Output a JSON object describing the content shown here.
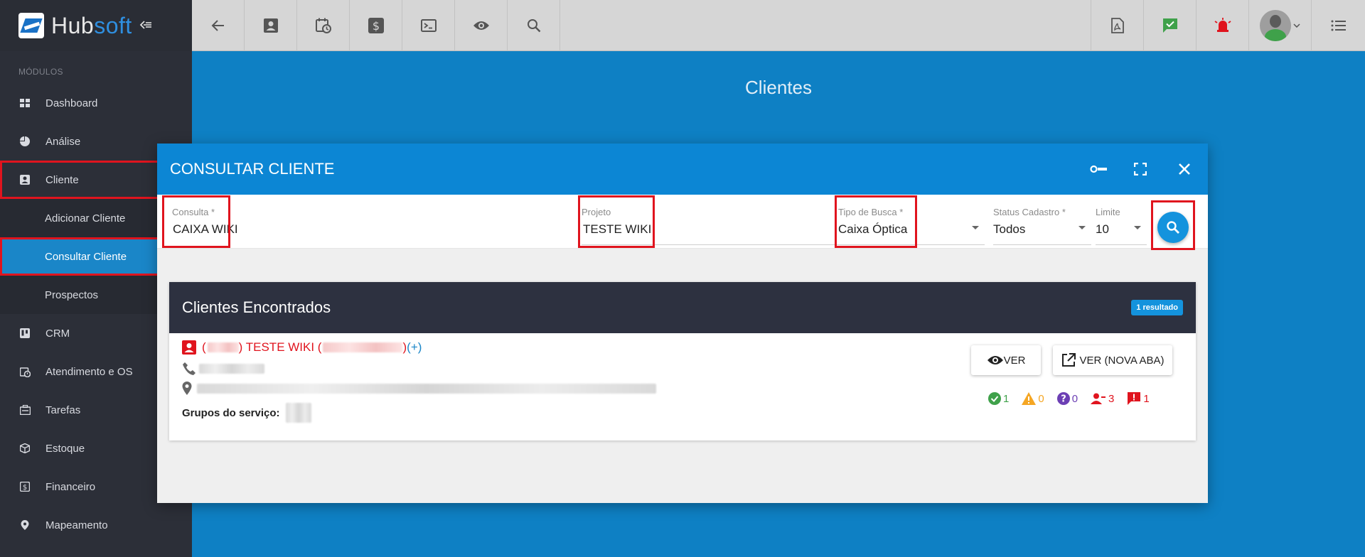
{
  "app": {
    "logo_hub": "Hub",
    "logo_soft": "soft"
  },
  "sidebar": {
    "section_label": "MÓDULOS",
    "items": [
      {
        "label": "Dashboard"
      },
      {
        "label": "Análise"
      },
      {
        "label": "Cliente"
      },
      {
        "label": "CRM"
      },
      {
        "label": "Atendimento e OS"
      },
      {
        "label": "Tarefas"
      },
      {
        "label": "Estoque"
      },
      {
        "label": "Financeiro"
      },
      {
        "label": "Mapeamento"
      }
    ],
    "subitems": [
      {
        "label": "Adicionar Cliente"
      },
      {
        "label": "Consultar Cliente"
      },
      {
        "label": "Prospectos"
      }
    ]
  },
  "page": {
    "title": "Clientes"
  },
  "modal": {
    "title": "CONSULTAR CLIENTE",
    "fields": {
      "consulta": {
        "label": "Consulta",
        "required_mark": "*",
        "value": "CAIXA WIKI"
      },
      "projeto": {
        "label": "Projeto",
        "value": "TESTE WIKI"
      },
      "tipo_busca": {
        "label": "Tipo de Busca",
        "required_mark": "*",
        "value": "Caixa Óptica"
      },
      "status_cadastro": {
        "label": "Status Cadastro",
        "required_mark": "*",
        "value": "Todos"
      },
      "limite": {
        "label": "Limite",
        "value": "10"
      }
    }
  },
  "results": {
    "title": "Clientes Encontrados",
    "badge": "1 resultado",
    "client": {
      "open_paren": "(",
      "name": ") TESTE WIKI (",
      "close_paren": ")",
      "plus": "(+)",
      "groups_label": "Grupos do serviço:",
      "btn_view": "VER",
      "btn_view_new_tab": "VER (NOVA ABA)",
      "stats": {
        "ok": "1",
        "warning": "0",
        "question": "0",
        "users": "3",
        "alerts": "1"
      }
    }
  },
  "colors": {
    "accent": "#0c86d4",
    "highlight": "#e0141e",
    "sidebar_bg": "#2c2f38",
    "ok": "#3fa14a",
    "warning": "#f5a623",
    "question": "#6c3fb4",
    "danger": "#e0141e"
  }
}
